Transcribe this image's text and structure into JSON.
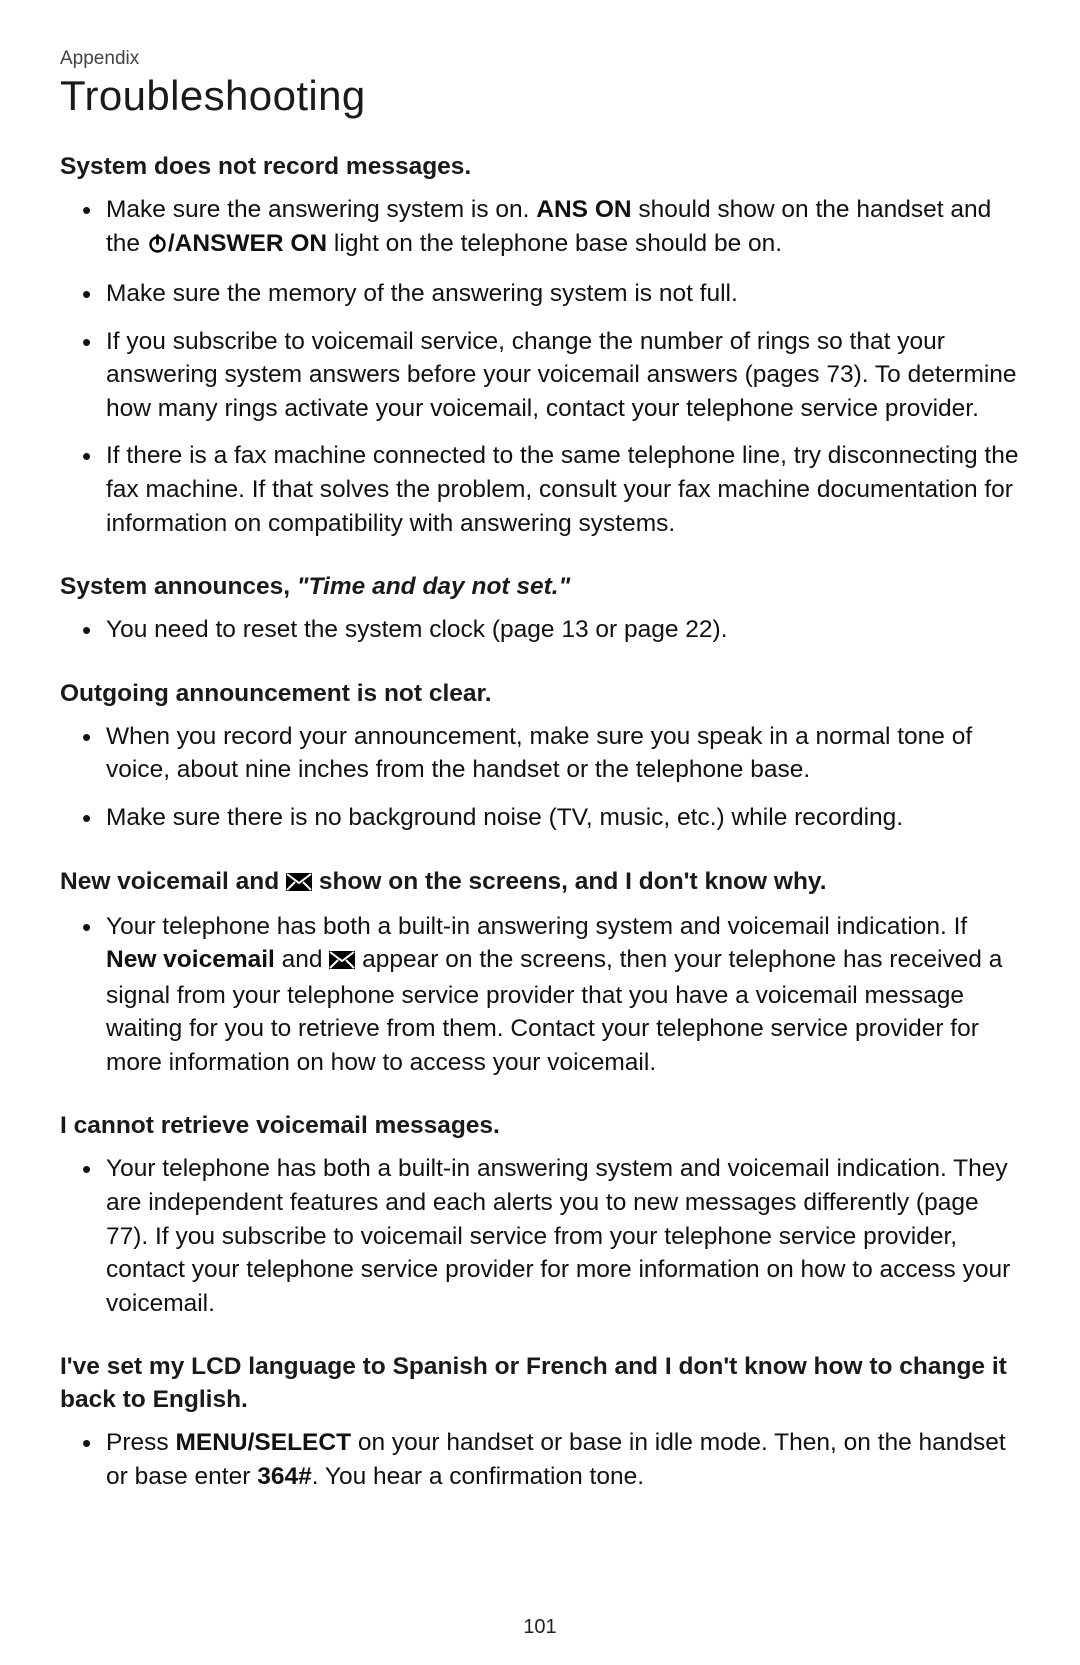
{
  "header": {
    "appendix_label": "Appendix",
    "section_title": "Troubleshooting"
  },
  "issues": [
    {
      "heading_plain": "System does not record messages.",
      "heading_italic": ""
    },
    {
      "heading_plain": "System announces, ",
      "heading_italic": "\"Time and day not set.\""
    },
    {
      "heading_plain": "Outgoing announcement is not clear.",
      "heading_italic": ""
    },
    {
      "heading_plain": "New voicemail and ",
      "heading_plain2": " show on the screens, and I don't know why.",
      "heading_italic": ""
    },
    {
      "heading_plain": "I cannot retrieve voicemail messages.",
      "heading_italic": ""
    },
    {
      "heading_plain": "I've set my LCD language to Spanish or French and I don't know how to change it back to English.",
      "heading_italic": ""
    }
  ],
  "bullets": {
    "i0b0": {
      "pre": "Make sure the answering system is on. ",
      "bold1": "ANS ON",
      "mid": " should show on the handset and the ",
      "bold2": "/ANSWER ON",
      "post": " light on the telephone base should be on."
    },
    "i0b1": "Make sure the memory of the answering system is not full.",
    "i0b2": "If you subscribe to voicemail service, change the number of rings so that your answering system answers before your voicemail answers (pages 73). To determine how many rings activate your voicemail, contact your telephone service provider.",
    "i0b3": "If there is a fax machine connected to the same telephone line, try disconnecting the fax machine. If that solves the problem, consult your fax machine documentation for information on compatibility with answering systems.",
    "i1b0": "You need to reset the system clock (page 13 or page 22).",
    "i2b0": "When you record your announcement, make sure you speak in a normal tone of voice, about nine inches from the handset or the telephone base.",
    "i2b1": "Make sure there is no background noise (TV, music, etc.) while recording.",
    "i3b0": {
      "pre": "Your telephone has both a built-in answering system and voicemail indication. If ",
      "bold1": "New voicemail",
      "mid": " and ",
      "post": " appear on the screens, then your telephone has received a signal from your telephone service provider that you have a voicemail message waiting for you to retrieve from them. Contact your telephone service provider for more information on how to access your voicemail."
    },
    "i4b0": "Your telephone has both a built-in answering system and voicemail indication. They are independent features and each alerts you to new messages differently (page 77). If you subscribe to voicemail service from your telephone service provider, contact your telephone service provider for more information on how to access your voicemail.",
    "i5b0": {
      "pre": "Press ",
      "sc1": "MENU",
      "bold1": "/SELECT",
      "mid": " on your handset or base in idle mode. Then, on the handset or base enter ",
      "bold2": "364#",
      "post": ". You hear a confirmation tone."
    }
  },
  "page_number": "101"
}
